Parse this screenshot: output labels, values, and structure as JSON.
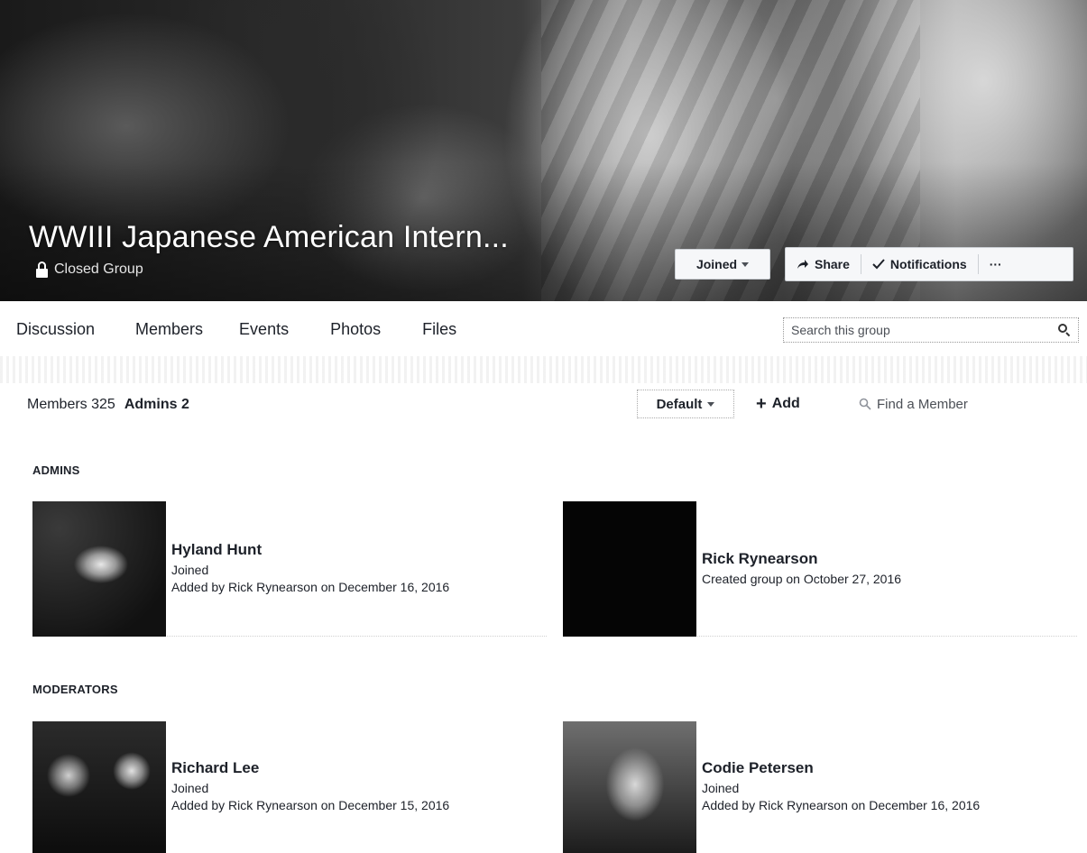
{
  "group": {
    "title": "WWIII Japanese American Intern...",
    "privacy": "Closed Group"
  },
  "cover_actions": {
    "joined": "Joined",
    "share": "Share",
    "notifications": "Notifications",
    "more": "···"
  },
  "tabs": [
    "Discussion",
    "Members",
    "Events",
    "Photos",
    "Files"
  ],
  "search": {
    "placeholder": "Search this group"
  },
  "members_bar": {
    "members_count": "Members 325",
    "admins_count": "Admins 2",
    "sort": "Default",
    "add": "Add",
    "find": "Find a Member"
  },
  "sections": {
    "admins": {
      "heading": "ADMINS",
      "members": [
        {
          "name": "Hyland Hunt",
          "line1": "Joined",
          "line2": "Added by Rick Rynearson on December 16, 2016"
        },
        {
          "name": "Rick Rynearson",
          "line1": "Created group on October 27, 2016",
          "line2": ""
        }
      ]
    },
    "moderators": {
      "heading": "MODERATORS",
      "members": [
        {
          "name": "Richard Lee",
          "line1": "Joined",
          "line2": "Added by Rick Rynearson on December 15, 2016"
        },
        {
          "name": "Codie Petersen",
          "line1": "Joined",
          "line2": "Added by Rick Rynearson on December 16, 2016"
        }
      ]
    }
  },
  "icons": {
    "lock": "lock-icon",
    "share": "share-arrow-icon",
    "notifications": "checkmark-icon",
    "search": "search-icon",
    "find": "search-icon",
    "caret": "caret-down-icon"
  }
}
